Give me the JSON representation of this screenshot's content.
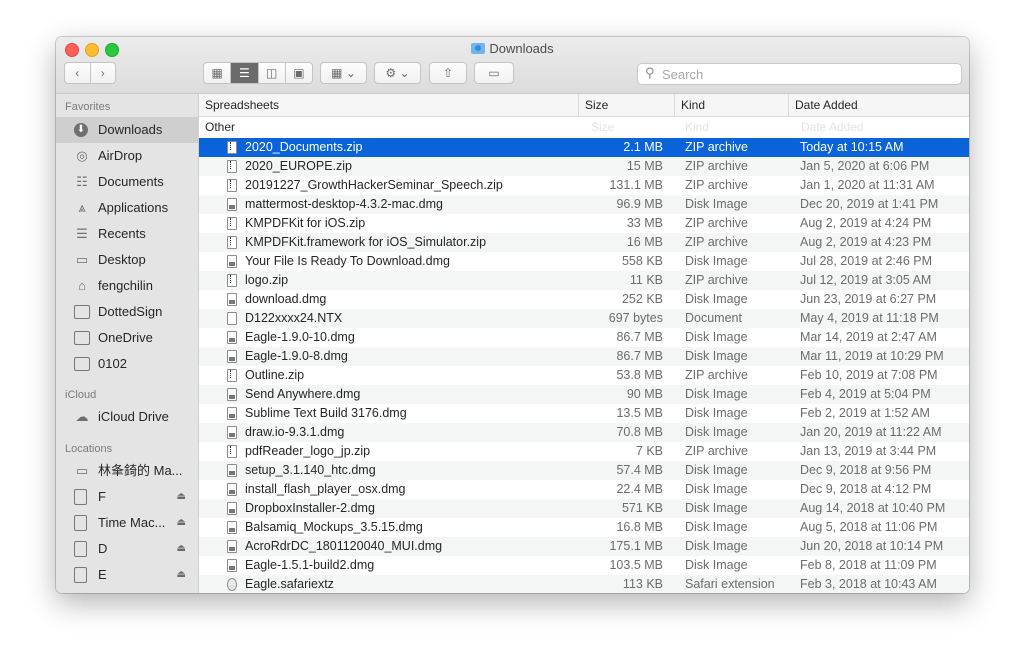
{
  "window": {
    "title": "Downloads"
  },
  "toolbar": {
    "view_icons": [
      "icon-view-icon",
      "list-view-icon",
      "column-view-icon",
      "gallery-view-icon"
    ],
    "search_placeholder": "Search"
  },
  "sidebar": {
    "favorites_heading": "Favorites",
    "favorites": [
      {
        "label": "Downloads",
        "icon": "downloads-icon",
        "selected": true
      },
      {
        "label": "AirDrop",
        "icon": "airdrop-icon"
      },
      {
        "label": "Documents",
        "icon": "documents-icon"
      },
      {
        "label": "Applications",
        "icon": "applications-icon"
      },
      {
        "label": "Recents",
        "icon": "recents-icon"
      },
      {
        "label": "Desktop",
        "icon": "desktop-icon"
      },
      {
        "label": "fengchilin",
        "icon": "home-icon"
      },
      {
        "label": "DottedSign",
        "icon": "folder-icon"
      },
      {
        "label": "OneDrive",
        "icon": "folder-icon"
      },
      {
        "label": "0102",
        "icon": "folder-icon"
      }
    ],
    "icloud_heading": "iCloud",
    "icloud": [
      {
        "label": "iCloud Drive",
        "icon": "cloud-icon"
      }
    ],
    "locations_heading": "Locations",
    "locations": [
      {
        "label": "林夆錡的 Ma...",
        "icon": "computer-icon",
        "eject": false
      },
      {
        "label": "F",
        "icon": "disk-icon",
        "eject": true
      },
      {
        "label": "Time Mac...",
        "icon": "disk-icon",
        "eject": true
      },
      {
        "label": "D",
        "icon": "disk-icon",
        "eject": true
      },
      {
        "label": "E",
        "icon": "disk-icon",
        "eject": true
      }
    ]
  },
  "columns": {
    "name": "Spreadsheets",
    "size": "Size",
    "kind": "Kind",
    "date": "Date Added"
  },
  "group": {
    "label": "Other",
    "ghost_size": "Size",
    "ghost_kind": "Kind",
    "ghost_date": "Date Added"
  },
  "files": [
    {
      "name": "2020_Documents.zip",
      "size": "2.1 MB",
      "kind": "ZIP archive",
      "date": "Today at 10:15 AM",
      "type": "zip",
      "selected": true
    },
    {
      "name": "2020_EUROPE.zip",
      "size": "15 MB",
      "kind": "ZIP archive",
      "date": "Jan 5, 2020 at 6:06 PM",
      "type": "zip"
    },
    {
      "name": "20191227_GrowthHackerSeminar_Speech.zip",
      "size": "131.1 MB",
      "kind": "ZIP archive",
      "date": "Jan 1, 2020 at 11:31 AM",
      "type": "zip"
    },
    {
      "name": "mattermost-desktop-4.3.2-mac.dmg",
      "size": "96.9 MB",
      "kind": "Disk Image",
      "date": "Dec 20, 2019 at 1:41 PM",
      "type": "dmg"
    },
    {
      "name": "KMPDFKit for iOS.zip",
      "size": "33 MB",
      "kind": "ZIP archive",
      "date": "Aug 2, 2019 at 4:24 PM",
      "type": "zip"
    },
    {
      "name": "KMPDFKit.framework for iOS_Simulator.zip",
      "size": "16 MB",
      "kind": "ZIP archive",
      "date": "Aug 2, 2019 at 4:23 PM",
      "type": "zip"
    },
    {
      "name": "Your File Is Ready To Download.dmg",
      "size": "558 KB",
      "kind": "Disk Image",
      "date": "Jul 28, 2019 at 2:46 PM",
      "type": "dmg"
    },
    {
      "name": "logo.zip",
      "size": "11 KB",
      "kind": "ZIP archive",
      "date": "Jul 12, 2019 at 3:05 AM",
      "type": "zip"
    },
    {
      "name": "download.dmg",
      "size": "252 KB",
      "kind": "Disk Image",
      "date": "Jun 23, 2019 at 6:27 PM",
      "type": "dmg"
    },
    {
      "name": "D122xxxx24.NTX",
      "size": "697 bytes",
      "kind": "Document",
      "date": "May 4, 2019 at 11:18 PM",
      "type": "doc"
    },
    {
      "name": "Eagle-1.9.0-10.dmg",
      "size": "86.7 MB",
      "kind": "Disk Image",
      "date": "Mar 14, 2019 at 2:47 AM",
      "type": "dmg"
    },
    {
      "name": "Eagle-1.9.0-8.dmg",
      "size": "86.7 MB",
      "kind": "Disk Image",
      "date": "Mar 11, 2019 at 10:29 PM",
      "type": "dmg"
    },
    {
      "name": "Outline.zip",
      "size": "53.8 MB",
      "kind": "ZIP archive",
      "date": "Feb 10, 2019 at 7:08 PM",
      "type": "zip"
    },
    {
      "name": "Send Anywhere.dmg",
      "size": "90 MB",
      "kind": "Disk Image",
      "date": "Feb 4, 2019 at 5:04 PM",
      "type": "dmg"
    },
    {
      "name": "Sublime Text Build 3176.dmg",
      "size": "13.5 MB",
      "kind": "Disk Image",
      "date": "Feb 2, 2019 at 1:52 AM",
      "type": "dmg"
    },
    {
      "name": "draw.io-9.3.1.dmg",
      "size": "70.8 MB",
      "kind": "Disk Image",
      "date": "Jan 20, 2019 at 11:22 AM",
      "type": "dmg"
    },
    {
      "name": "pdfReader_logo_jp.zip",
      "size": "7 KB",
      "kind": "ZIP archive",
      "date": "Jan 13, 2019 at 3:44 PM",
      "type": "zip"
    },
    {
      "name": "setup_3.1.140_htc.dmg",
      "size": "57.4 MB",
      "kind": "Disk Image",
      "date": "Dec 9, 2018 at 9:56 PM",
      "type": "dmg"
    },
    {
      "name": "install_flash_player_osx.dmg",
      "size": "22.4 MB",
      "kind": "Disk Image",
      "date": "Dec 9, 2018 at 4:12 PM",
      "type": "dmg"
    },
    {
      "name": "DropboxInstaller-2.dmg",
      "size": "571 KB",
      "kind": "Disk Image",
      "date": "Aug 14, 2018 at 10:40 PM",
      "type": "dmg"
    },
    {
      "name": "Balsamiq_Mockups_3.5.15.dmg",
      "size": "16.8 MB",
      "kind": "Disk Image",
      "date": "Aug 5, 2018 at 11:06 PM",
      "type": "dmg"
    },
    {
      "name": "AcroRdrDC_1801120040_MUI.dmg",
      "size": "175.1 MB",
      "kind": "Disk Image",
      "date": "Jun 20, 2018 at 10:14 PM",
      "type": "dmg"
    },
    {
      "name": "Eagle-1.5.1-build2.dmg",
      "size": "103.5 MB",
      "kind": "Disk Image",
      "date": "Feb 8, 2018 at 11:09 PM",
      "type": "dmg"
    },
    {
      "name": "Eagle.safariextz",
      "size": "113 KB",
      "kind": "Safari extension",
      "date": "Feb 3, 2018 at 10:43 AM",
      "type": "ext"
    }
  ]
}
